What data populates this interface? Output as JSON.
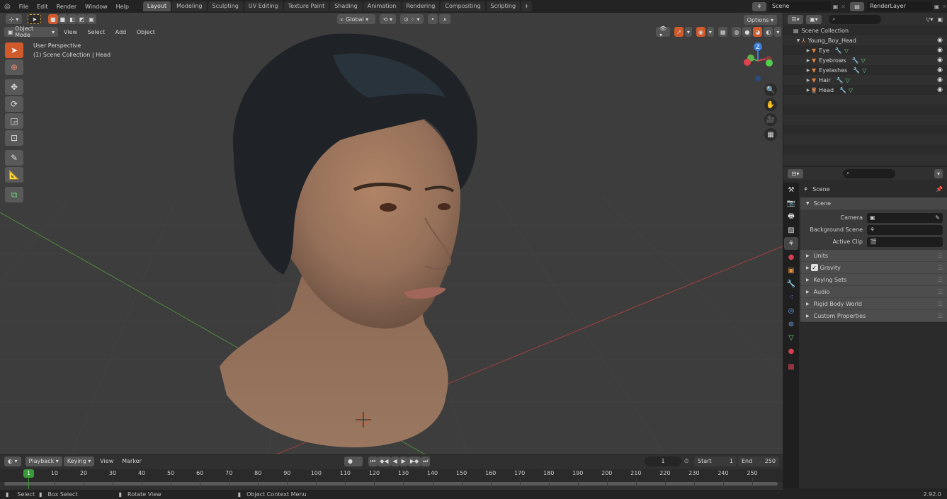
{
  "app": {
    "version": "2.92.0"
  },
  "menubar": {
    "items": [
      "File",
      "Edit",
      "Render",
      "Window",
      "Help"
    ],
    "workspaces": [
      "Layout",
      "Modeling",
      "Sculpting",
      "UV Editing",
      "Texture Paint",
      "Shading",
      "Animation",
      "Rendering",
      "Compositing",
      "Scripting"
    ],
    "active_workspace": "Layout",
    "add_workspace": "+",
    "scene": "Scene",
    "view_layer": "RenderLayer"
  },
  "viewport": {
    "header": {
      "transform_orientation": "Global",
      "options_label": "Options",
      "mode": "Object Mode",
      "menus": [
        "View",
        "Select",
        "Add",
        "Object"
      ]
    },
    "overlay_text": {
      "line1": "User Perspective",
      "line2": "(1) Scene Collection | Head"
    },
    "tools": [
      "select-box",
      "cursor",
      "move",
      "rotate",
      "scale",
      "transform",
      "annotate",
      "measure",
      "add-cube"
    ],
    "active_tool": "select-box",
    "gizmo": {
      "z_label": "Z",
      "y_label": "Y",
      "x_color": "#e04050",
      "y_color": "#5ab54a",
      "z_color": "#3b7dd8"
    },
    "nav_buttons": [
      "zoom",
      "pan",
      "camera",
      "perspective"
    ]
  },
  "outliner": {
    "search_placeholder": "",
    "root": "Scene Collection",
    "collection": "Young_Boy_Head",
    "objects": [
      {
        "name": "Eye"
      },
      {
        "name": "Eyebrows"
      },
      {
        "name": "Eyelashes"
      },
      {
        "name": "Hair"
      },
      {
        "name": "Head"
      }
    ]
  },
  "properties": {
    "search_placeholder": "",
    "context_title": "Scene",
    "panel_title": "Scene",
    "fields": [
      {
        "label": "Camera",
        "value": ""
      },
      {
        "label": "Background Scene",
        "value": ""
      },
      {
        "label": "Active Clip",
        "value": ""
      }
    ],
    "subpanels": [
      {
        "label": "Units",
        "checkbox": false
      },
      {
        "label": "Gravity",
        "checkbox": true,
        "checked": true
      },
      {
        "label": "Keying Sets",
        "checkbox": false
      },
      {
        "label": "Audio",
        "checkbox": false
      },
      {
        "label": "Rigid Body World",
        "checkbox": false
      },
      {
        "label": "Custom Properties",
        "checkbox": false
      }
    ]
  },
  "timeline": {
    "menus": [
      "Playback",
      "Keying",
      "View",
      "Marker"
    ],
    "current_frame": "1",
    "start_label": "Start",
    "start": "1",
    "end_label": "End",
    "end": "250",
    "ticks": [
      "1",
      "10",
      "20",
      "30",
      "40",
      "50",
      "60",
      "70",
      "80",
      "90",
      "100",
      "110",
      "120",
      "130",
      "140",
      "150",
      "160",
      "170",
      "180",
      "190",
      "200",
      "210",
      "220",
      "230",
      "240",
      "250"
    ],
    "playhead_color": "#3a9a3a"
  },
  "statusbar": {
    "select": "Select",
    "box_select": "Box Select",
    "rotate_view": "Rotate View",
    "context_menu": "Object Context Menu",
    "version": "2.92.0"
  }
}
